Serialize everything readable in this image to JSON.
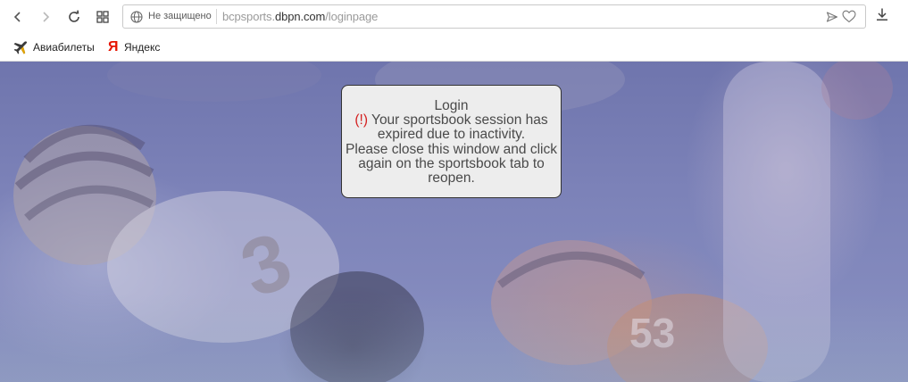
{
  "browser": {
    "nav": {
      "back_icon": "chevron-left-icon",
      "forward_icon": "chevron-right-icon",
      "reload_icon": "reload-icon",
      "tabs_icon": "grid-icon"
    },
    "address_bar": {
      "security_label": "Не защищено",
      "url_prefix": "bcpsports.",
      "url_domain": "dbpn.com",
      "url_path": "/loginpage"
    },
    "bookmarks": [
      {
        "label": "Авиабилеты",
        "icon": "airplane-icon"
      },
      {
        "label": "Яндекс",
        "icon": "yandex-icon",
        "glyph": "Я"
      }
    ]
  },
  "dialog": {
    "title": "Login",
    "warning_mark": "(!)",
    "message_line1": " Your sportsbook session has expired due to inactivity.",
    "message_line2": "Please close this window and click again on the sportsbook tab to reopen."
  },
  "colors": {
    "overlay": "#7c82b8",
    "warning": "#d42020",
    "yandex": "#e61400"
  }
}
